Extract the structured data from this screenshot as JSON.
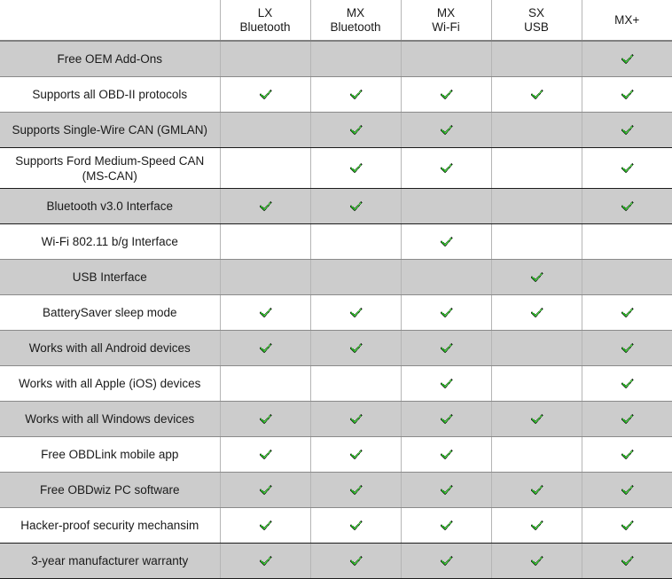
{
  "table": {
    "corner_label": "",
    "check_icon": "check-mark-icon",
    "colors": {
      "check_fill": "#22c11e",
      "check_outline": "#111111",
      "check_highlight": "#7ce86f",
      "row_shade": "#cccccc",
      "row_plain": "#ffffff",
      "header_rule": "#808080",
      "row_rule": "#8a8a8a",
      "col_rule": "#b5b5b5",
      "text": "#1a1a1a"
    },
    "columns": [
      {
        "id": "lx-bluetooth",
        "line1": "LX",
        "line2": "Bluetooth"
      },
      {
        "id": "mx-bluetooth",
        "line1": "MX",
        "line2": "Bluetooth"
      },
      {
        "id": "mx-wifi",
        "line1": "MX",
        "line2": "Wi-Fi"
      },
      {
        "id": "sx-usb",
        "line1": "SX",
        "line2": "USB"
      },
      {
        "id": "mx-plus",
        "line1": "MX+",
        "line2": ""
      }
    ],
    "rows": [
      {
        "id": "free-oem-add-ons",
        "line1": "Free OEM Add-Ons",
        "line2": "",
        "shade": true,
        "values": [
          false,
          false,
          false,
          false,
          true
        ]
      },
      {
        "id": "all-obd-ii-protocols",
        "line1": "Supports all OBD-II protocols",
        "line2": "",
        "shade": false,
        "values": [
          true,
          true,
          true,
          true,
          true
        ]
      },
      {
        "id": "single-wire-can-gmlan",
        "line1": "Supports Single-Wire CAN (GMLAN)",
        "line2": "",
        "shade": true,
        "values": [
          false,
          true,
          true,
          false,
          true
        ]
      },
      {
        "id": "ford-ms-can",
        "line1": "Supports Ford Medium-Speed CAN",
        "line2": "(MS-CAN)",
        "shade": false,
        "values": [
          false,
          true,
          true,
          false,
          true
        ]
      },
      {
        "id": "bluetooth-v30",
        "line1": "Bluetooth v3.0 Interface",
        "line2": "",
        "shade": true,
        "values": [
          true,
          true,
          false,
          false,
          true
        ]
      },
      {
        "id": "wifi-802-11-bg",
        "line1": "Wi-Fi 802.11 b/g Interface",
        "line2": "",
        "shade": false,
        "values": [
          false,
          false,
          true,
          false,
          false
        ]
      },
      {
        "id": "usb-interface",
        "line1": "USB Interface",
        "line2": "",
        "shade": true,
        "values": [
          false,
          false,
          false,
          true,
          false
        ]
      },
      {
        "id": "batterysaver-sleep",
        "line1": "BatterySaver sleep mode",
        "line2": "",
        "shade": false,
        "values": [
          true,
          true,
          true,
          true,
          true
        ]
      },
      {
        "id": "android-devices",
        "line1": "Works with all Android devices",
        "line2": "",
        "shade": true,
        "values": [
          true,
          true,
          true,
          false,
          true
        ]
      },
      {
        "id": "apple-ios-devices",
        "line1": "Works with all Apple (iOS) devices",
        "line2": "",
        "shade": false,
        "values": [
          false,
          false,
          true,
          false,
          true
        ]
      },
      {
        "id": "windows-devices",
        "line1": "Works with all Windows devices",
        "line2": "",
        "shade": true,
        "values": [
          true,
          true,
          true,
          true,
          true
        ]
      },
      {
        "id": "obdlink-mobile-app",
        "line1": "Free OBDLink mobile app",
        "line2": "",
        "shade": false,
        "values": [
          true,
          true,
          true,
          false,
          true
        ]
      },
      {
        "id": "obdwiz-pc-software",
        "line1": "Free OBDwiz PC software",
        "line2": "",
        "shade": true,
        "values": [
          true,
          true,
          true,
          true,
          true
        ]
      },
      {
        "id": "hacker-proof-security",
        "line1": "Hacker-proof security mechansim",
        "line2": "",
        "shade": false,
        "values": [
          true,
          true,
          true,
          true,
          true
        ]
      },
      {
        "id": "3-year-warranty",
        "line1": "3-year manufacturer warranty",
        "line2": "",
        "shade": true,
        "values": [
          true,
          true,
          true,
          true,
          true
        ]
      }
    ]
  }
}
